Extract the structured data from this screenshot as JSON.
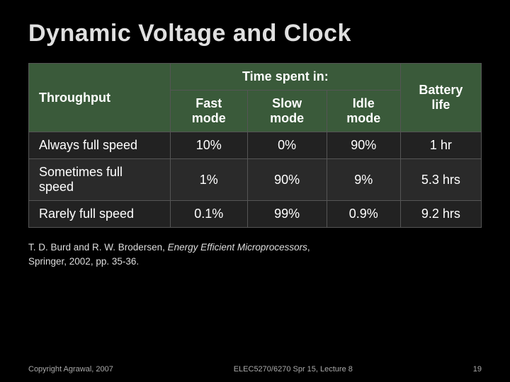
{
  "title": "Dynamic Voltage and Clock",
  "table": {
    "header": {
      "throughput_label": "Throughput",
      "time_spent_label": "Time spent in:",
      "fast_mode_label": "Fast mode",
      "slow_mode_label": "Slow mode",
      "idle_mode_label": "Idle mode",
      "battery_life_label": "Battery life"
    },
    "rows": [
      {
        "label": "Always full speed",
        "fast": "10%",
        "slow": "0%",
        "idle": "90%",
        "battery": "1 hr"
      },
      {
        "label": "Sometimes full speed",
        "fast": "1%",
        "slow": "90%",
        "idle": "9%",
        "battery": "5.3 hrs"
      },
      {
        "label": "Rarely full speed",
        "fast": "0.1%",
        "slow": "99%",
        "idle": "0.9%",
        "battery": "9.2 hrs"
      }
    ]
  },
  "footnote": {
    "line1_prefix": "T. D. Burd and R. W. Brodersen, ",
    "line1_italic": "Energy Efficient Microprocessors",
    "line1_suffix": ",",
    "line2": "Springer, 2002, pp. 35-36."
  },
  "footer": {
    "copyright": "Copyright Agrawal, 2007",
    "course": "ELEC5270/6270 Spr 15, Lecture 8",
    "page": "19"
  }
}
